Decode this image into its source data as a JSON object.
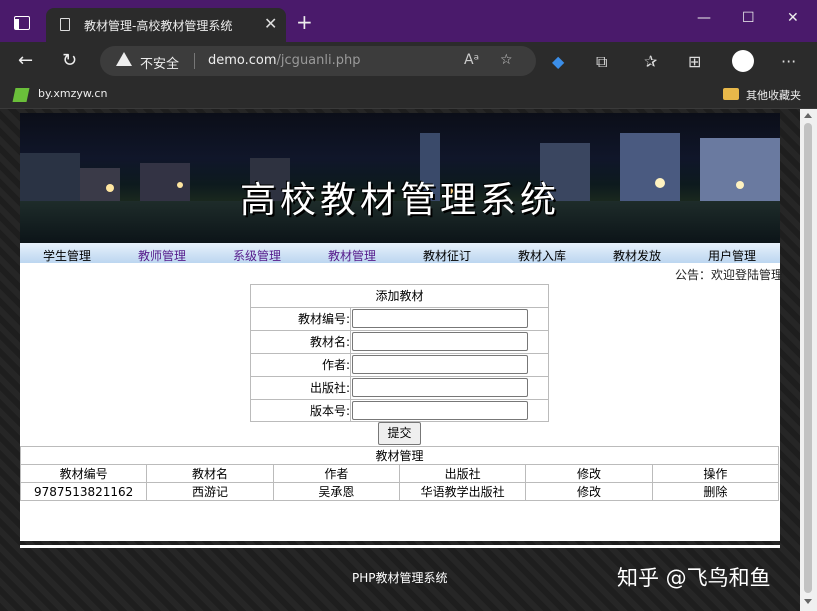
{
  "browser": {
    "tab_title": "教材管理-高校教材管理系统",
    "security_label": "不安全",
    "url_host": "demo.com",
    "url_path": "/jcguanli.php",
    "bookmark_left": "by.xmzyw.cn",
    "bookmark_right": "其他收藏夹"
  },
  "banner": {
    "title": "高校教材管理系统"
  },
  "nav": {
    "items": [
      {
        "label": "学生管理",
        "color": "#000000"
      },
      {
        "label": "教师管理",
        "color": "#551a8b"
      },
      {
        "label": "系级管理",
        "color": "#551a8b"
      },
      {
        "label": "教材管理",
        "color": "#551a8b"
      },
      {
        "label": "教材征订",
        "color": "#000000"
      },
      {
        "label": "教材入库",
        "color": "#000000"
      },
      {
        "label": "教材发放",
        "color": "#000000"
      },
      {
        "label": "用户管理",
        "color": "#000000"
      }
    ]
  },
  "notice": "公告：欢迎登陆管理",
  "form": {
    "title": "添加教材",
    "fields": [
      {
        "label": "教材编号:",
        "value": ""
      },
      {
        "label": "教材名:",
        "value": ""
      },
      {
        "label": "作者:",
        "value": ""
      },
      {
        "label": "出版社:",
        "value": ""
      },
      {
        "label": "版本号:",
        "value": ""
      }
    ],
    "submit_label": "提交"
  },
  "table": {
    "caption": "教材管理",
    "headers": [
      "教材编号",
      "教材名",
      "作者",
      "出版社",
      "修改",
      "操作"
    ],
    "rows": [
      [
        "9787513821162",
        "西游记",
        "吴承恩",
        "华语教学出版社",
        "修改",
        "删除"
      ]
    ]
  },
  "footer": "PHP教材管理系统",
  "watermark": "知乎 @飞鸟和鱼"
}
